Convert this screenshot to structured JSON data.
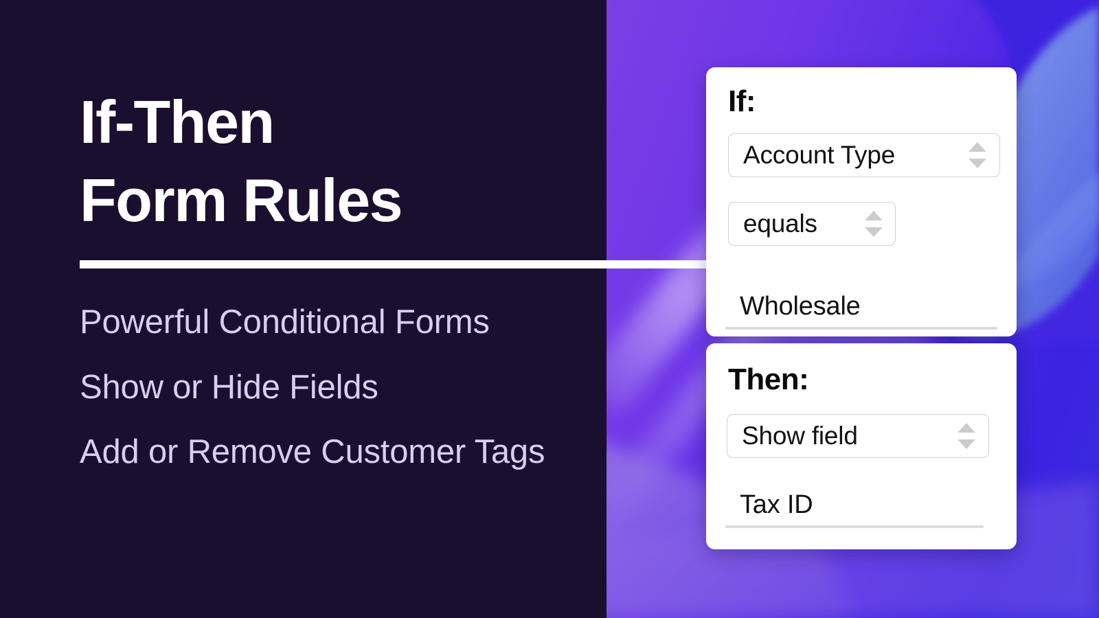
{
  "hero": {
    "headline": "If-Then\nForm Rules",
    "divider": "horizontal-rule",
    "bullets": [
      "Powerful Conditional Forms",
      "Show or Hide Fields",
      "Add or Remove Customer Tags"
    ]
  },
  "rule_builder": {
    "if_card": {
      "title": "If:",
      "field_select": {
        "value": "Account Type",
        "stepper_icon": "stepper-arrows-icon"
      },
      "operator_select": {
        "value": "equals",
        "stepper_icon": "stepper-arrows-icon"
      },
      "value_input": {
        "value": "Wholesale"
      }
    },
    "then_card": {
      "title": "Then:",
      "action_select": {
        "value": "Show field",
        "stepper_icon": "stepper-arrows-icon"
      },
      "target_input": {
        "value": "Tax ID"
      }
    }
  },
  "colors": {
    "panel_dark": "#1a0f2e",
    "headline": "#ffffff",
    "bullet_text": "#d9cdf0",
    "gradient_start": "#7b3fe4",
    "gradient_end": "#3a2ce0",
    "card_background": "#ffffff",
    "card_text": "#111111",
    "control_border": "#d2d2d2",
    "stepper_arrow": "#cccccc"
  }
}
